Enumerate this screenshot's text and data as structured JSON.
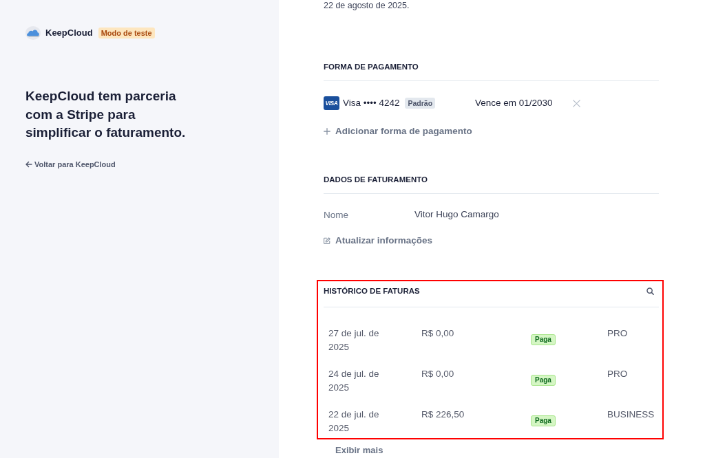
{
  "brand": {
    "name": "KeepCloud",
    "badge": "Modo de teste"
  },
  "headline": "KeepCloud tem parceria com a Stripe para simplificar o faturamento.",
  "back_link": "Voltar para KeepCloud",
  "top_note": "22 de agosto de 2025.",
  "payment_method": {
    "title": "FORMA DE PAGAMENTO",
    "card": {
      "logo_text": "VISA",
      "number": "Visa •••• 4242",
      "badge": "Padrão",
      "expiry": "Vence em 01/2030"
    },
    "add_action": "Adicionar forma de pagamento"
  },
  "billing_details": {
    "title": "DADOS DE FATURAMENTO",
    "fields": [
      {
        "label": "Nome",
        "value": "Vitor Hugo Camargo"
      }
    ],
    "update_action": "Atualizar informações"
  },
  "invoice_history": {
    "title": "HISTÓRICO DE FATURAS",
    "highlighted": true,
    "rows": [
      {
        "date": "27 de jul. de 2025",
        "amount": "R$ 0,00",
        "status": "Paga",
        "plan": "PRO"
      },
      {
        "date": "24 de jul. de 2025",
        "amount": "R$ 0,00",
        "status": "Paga",
        "plan": "PRO"
      },
      {
        "date": "22 de jul. de 2025",
        "amount": "R$ 226,50",
        "status": "Paga",
        "plan": "BUSINESS"
      }
    ]
  },
  "more_action": "Exibir mais"
}
